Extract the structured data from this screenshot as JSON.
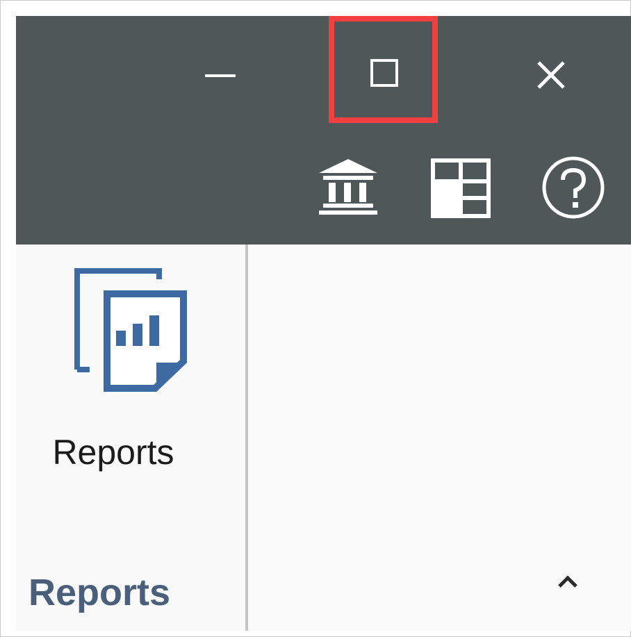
{
  "window": {
    "minimize_icon": "minimize-icon",
    "maximize_icon": "maximize-icon",
    "close_icon": "close-icon",
    "highlight_color": "#f24040",
    "titlebar_color": "#4f5759"
  },
  "toolbar": {
    "icons": [
      "bank-icon",
      "layout-grid-icon",
      "help-icon"
    ]
  },
  "ribbon": {
    "reports_button_label": "Reports",
    "reports_icon": "reports-icon",
    "group_label": "Reports",
    "collapse_icon": "chevron-up-icon",
    "accent_color": "#3d6aa2"
  }
}
